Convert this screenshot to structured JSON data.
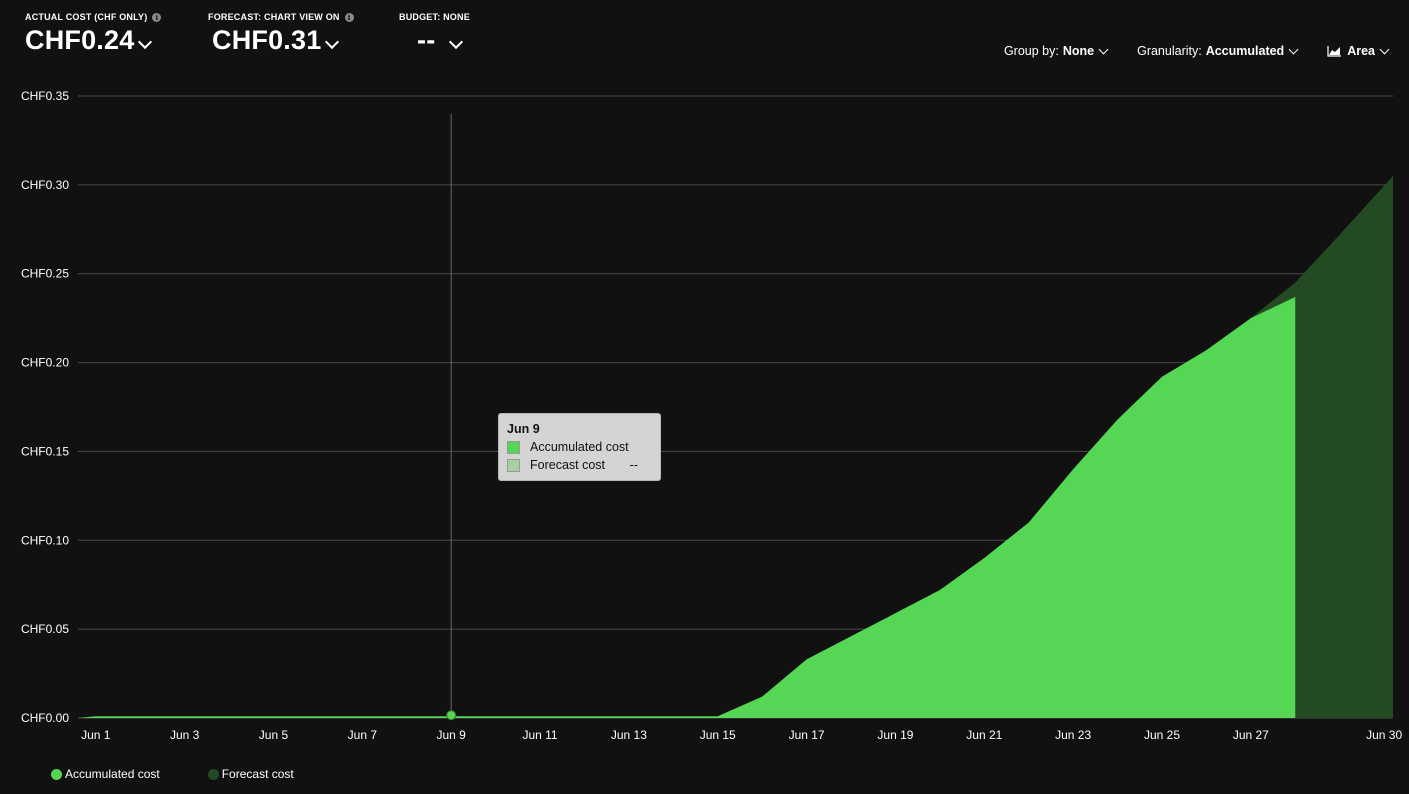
{
  "kpis": {
    "actual": {
      "label": "ACTUAL COST (CHF ONLY)",
      "value": "CHF0.24"
    },
    "forecast": {
      "label": "FORECAST: CHART VIEW ON",
      "value": "CHF0.31"
    },
    "budget": {
      "label": "BUDGET: NONE",
      "value": "--"
    }
  },
  "controls": {
    "group_by": {
      "label": "Group by:",
      "value": "None"
    },
    "granularity": {
      "label": "Granularity:",
      "value": "Accumulated"
    },
    "chart_type": {
      "value": "Area"
    }
  },
  "tooltip": {
    "title": "Jun 9",
    "rows": [
      {
        "label": "Accumulated cost",
        "value": ""
      },
      {
        "label": "Forecast cost",
        "value": "--"
      }
    ]
  },
  "colors": {
    "accumulated": "#55d655",
    "forecast": "#234a23",
    "background": "#111111",
    "grid": "#4a4a4a"
  },
  "chart_data": {
    "type": "area",
    "ylim": [
      0,
      0.35
    ],
    "y_ticks": [
      "CHF0.00",
      "CHF0.05",
      "CHF0.10",
      "CHF0.15",
      "CHF0.20",
      "CHF0.25",
      "CHF0.30",
      "CHF0.35"
    ],
    "y_tick_values": [
      0,
      0.05,
      0.1,
      0.15,
      0.2,
      0.25,
      0.3,
      0.35
    ],
    "x_ticks": [
      "Jun 1",
      "Jun 3",
      "Jun 5",
      "Jun 7",
      "Jun 9",
      "Jun 11",
      "Jun 13",
      "Jun 15",
      "Jun 17",
      "Jun 19",
      "Jun 21",
      "Jun 23",
      "Jun 25",
      "Jun 27",
      "Jun 30"
    ],
    "x_tick_days": [
      1,
      3,
      5,
      7,
      9,
      11,
      13,
      15,
      17,
      19,
      21,
      23,
      25,
      27,
      30
    ],
    "x_range": [
      0.6,
      30.2
    ],
    "series": [
      {
        "name": "Accumulated cost",
        "x": [
          0.6,
          1,
          2,
          3,
          4,
          5,
          6,
          7,
          8,
          9,
          10,
          11,
          12,
          13,
          14,
          15,
          16,
          17,
          18,
          19,
          20,
          21,
          22,
          23,
          24,
          25,
          26,
          27,
          28
        ],
        "values": [
          0.0,
          0.001,
          0.001,
          0.001,
          0.001,
          0.001,
          0.001,
          0.001,
          0.001,
          0.001,
          0.001,
          0.001,
          0.001,
          0.001,
          0.001,
          0.001,
          0.012,
          0.033,
          0.046,
          0.059,
          0.072,
          0.09,
          0.11,
          0.14,
          0.168,
          0.192,
          0.207,
          0.225,
          0.237
        ]
      },
      {
        "name": "Forecast cost",
        "x": [
          27,
          28,
          29,
          30.2
        ],
        "values": [
          0.225,
          0.245,
          0.272,
          0.305
        ]
      }
    ],
    "highlight": {
      "label": "Jun 9",
      "x": 9,
      "value": 0.001
    }
  },
  "legend": [
    {
      "label": "Accumulated cost",
      "color": "#55d655"
    },
    {
      "label": "Forecast cost",
      "color": "#234a23"
    }
  ]
}
